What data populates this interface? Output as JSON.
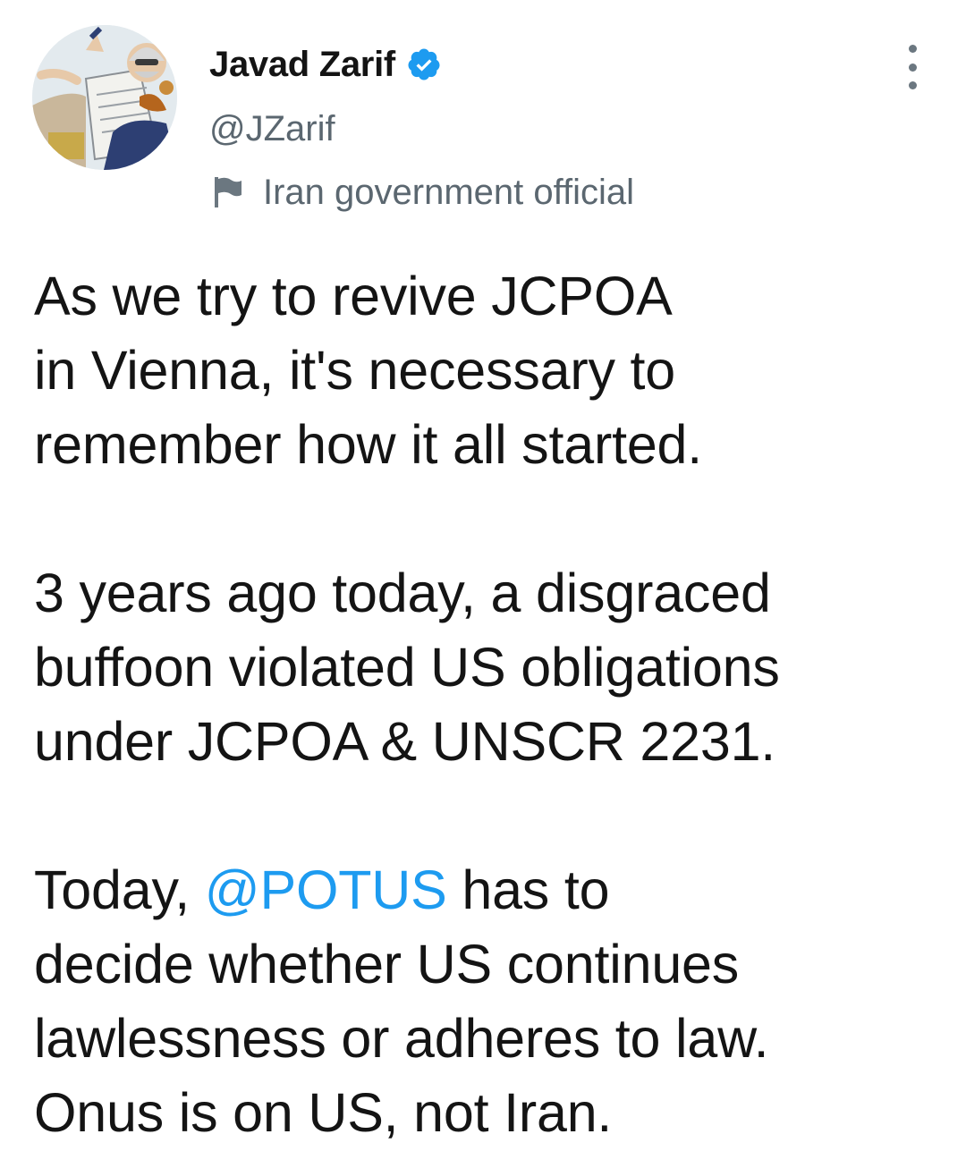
{
  "author": {
    "display_name": "Javad Zarif",
    "handle": "@JZarif",
    "verified": true,
    "label": "Iran government official",
    "avatar_icon": "caricature-avatar",
    "label_icon": "flag-icon",
    "verified_icon": "verified-badge-icon"
  },
  "menu": {
    "icon": "more-vertical-icon"
  },
  "tweet": {
    "paragraphs": [
      {
        "lines": [
          "As we try to revive JCPOA",
          "in Vienna, it's necessary to",
          "remember how it all started."
        ]
      },
      {
        "lines": [
          "3 years ago today, a disgraced",
          "buffoon violated US obligations",
          "under JCPOA & UNSCR 2231."
        ]
      },
      {
        "line1_before": "Today, ",
        "mention": "@POTUS",
        "line1_after": " has to",
        "lines_rest": [
          "decide whether US continues",
          "lawlessness or adheres to law.",
          "Onus is on US, not Iran."
        ]
      }
    ]
  },
  "colors": {
    "text": "#141414",
    "secondary": "#5b6770",
    "link": "#1d9bf0",
    "verified": "#1d9bf0"
  }
}
